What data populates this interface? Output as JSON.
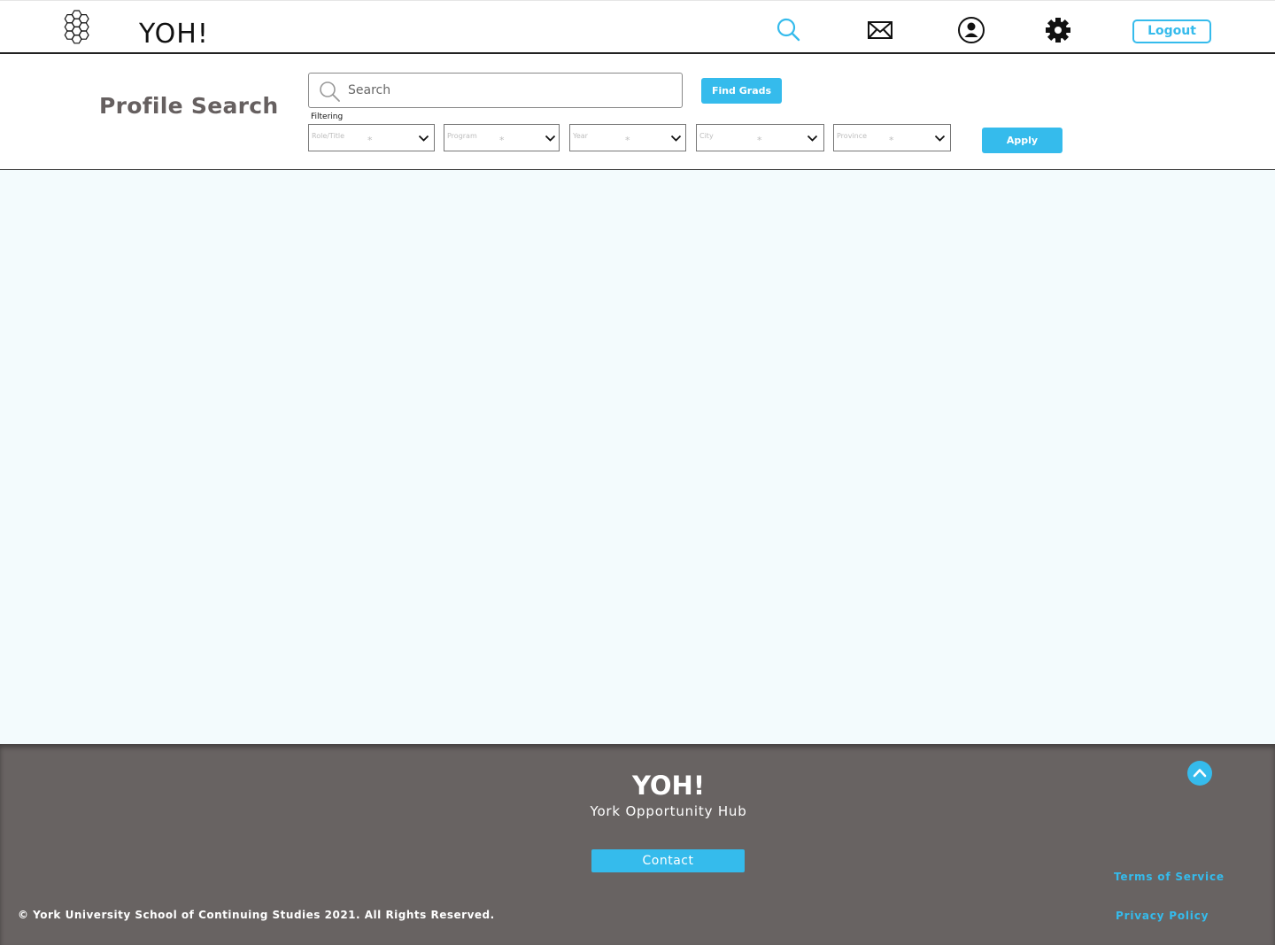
{
  "nav": {
    "brand": "YOH!",
    "icons": [
      "search-icon",
      "mail-icon",
      "profile-icon",
      "gear-icon"
    ],
    "logout_label": "Logout",
    "accent_color": "#35bbec"
  },
  "search": {
    "page_title": "Profile Search",
    "placeholder": "Search",
    "find_label": "Find Grads",
    "filtering_label": "Filtering",
    "filters": [
      {
        "label": "Role/Title"
      },
      {
        "label": "Program"
      },
      {
        "label": "Year"
      },
      {
        "label": "City"
      },
      {
        "label": "Province"
      }
    ],
    "apply_label": "Apply"
  },
  "footer": {
    "brand": "YOH!",
    "tagline": "York Opportunity Hub",
    "contact_label": "Contact",
    "copyright": "© York University School of Continuing Studies 2021. All Rights Reserved.",
    "terms_label": "Terms of Service",
    "privacy_label": "Privacy Policy",
    "background_color": "#686362"
  }
}
